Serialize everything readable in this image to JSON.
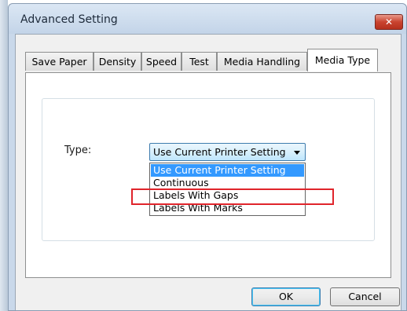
{
  "window": {
    "title": "Advanced Setting",
    "close_label": "✕"
  },
  "tabs": [
    {
      "label": "Save Paper",
      "active": false
    },
    {
      "label": "Density",
      "active": false
    },
    {
      "label": "Speed",
      "active": false
    },
    {
      "label": "Test",
      "active": false
    },
    {
      "label": "Media Handling",
      "active": false
    },
    {
      "label": "Media Type",
      "active": true
    }
  ],
  "form": {
    "type_label": "Type:",
    "type_value": "Use Current Printer Setting",
    "options": [
      "Use Current Printer Setting",
      "Continuous",
      "Labels With Gaps",
      "Labels With Marks"
    ],
    "highlighted_option": "Use Current Printer Setting",
    "annotated_option": "Labels With Gaps"
  },
  "buttons": {
    "ok": "OK",
    "cancel": "Cancel"
  },
  "colors": {
    "annotation": "#e0242b",
    "selection": "#3399ff",
    "close": "#c9432f"
  }
}
